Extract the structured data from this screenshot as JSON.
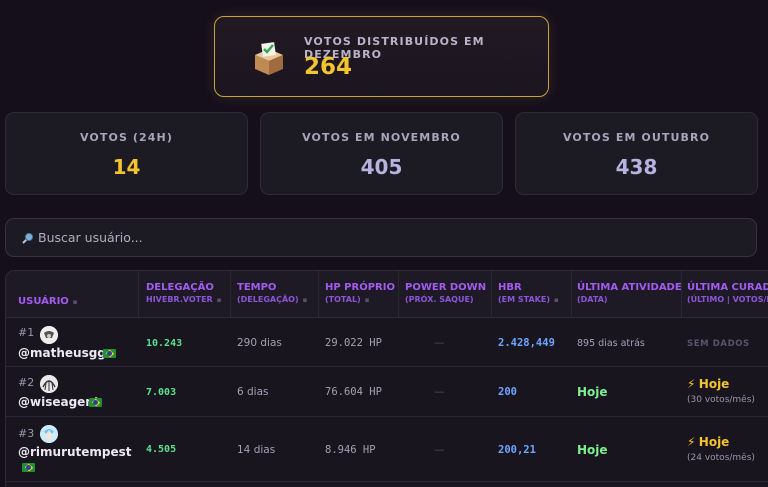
{
  "hero": {
    "label": "VOTOS DISTRIBUÍDOS EM DEZEMBRO",
    "value": "264",
    "icon": "ballot-box-icon",
    "accent": "#f4c430"
  },
  "stats": [
    {
      "label": "VOTOS (24H)",
      "value": "14",
      "color": "#f4c430"
    },
    {
      "label": "VOTOS EM NOVEMBRO",
      "value": "405",
      "color": "#b7b3e0"
    },
    {
      "label": "VOTOS EM OUTUBRO",
      "value": "438",
      "color": "#b7b3e0"
    }
  ],
  "search": {
    "placeholder": "Buscar usuário...",
    "value": ""
  },
  "table": {
    "headers": [
      {
        "title": "USUÁRIO",
        "sub": ""
      },
      {
        "title": "DELEGAÇÃO",
        "sub": "HIVEBR.VOTER"
      },
      {
        "title": "TEMPO",
        "sub": "(DELEGAÇÃO)"
      },
      {
        "title": "HP PRÓPRIO",
        "sub": "(TOTAL)"
      },
      {
        "title": "POWER DOWN",
        "sub": "(PRÓX. SAQUE)"
      },
      {
        "title": "HBR",
        "sub": "(EM STAKE)"
      },
      {
        "title": "ÚLTIMA ATIVIDADE",
        "sub": "(DATA)"
      },
      {
        "title": "ÚLTIMA CURADO",
        "sub": "(ÚLTIMO | VOTOS/M"
      }
    ],
    "rows": [
      {
        "rank": "#1",
        "username": "@matheusggr",
        "delegacao": "10.243",
        "tempo": "290 dias",
        "hp": "29.022 HP",
        "power_down": "—",
        "hbr": "2.428,449",
        "atividade": "895 dias atrás",
        "curadoria": "SEM DADOS",
        "curadoria_sub": ""
      },
      {
        "rank": "#2",
        "username": "@wiseagent",
        "delegacao": "7.003",
        "tempo": "6 dias",
        "hp": "76.604 HP",
        "power_down": "—",
        "hbr": "200",
        "atividade": "Hoje",
        "curadoria": "Hoje",
        "curadoria_sub": "(30 votos/mês)"
      },
      {
        "rank": "#3",
        "username": "@rimurutempest",
        "delegacao": "4.505",
        "tempo": "14 dias",
        "hp": "8.946 HP",
        "power_down": "—",
        "hbr": "200,21",
        "atividade": "Hoje",
        "curadoria": "Hoje",
        "curadoria_sub": "(24 votos/mês)"
      }
    ]
  }
}
